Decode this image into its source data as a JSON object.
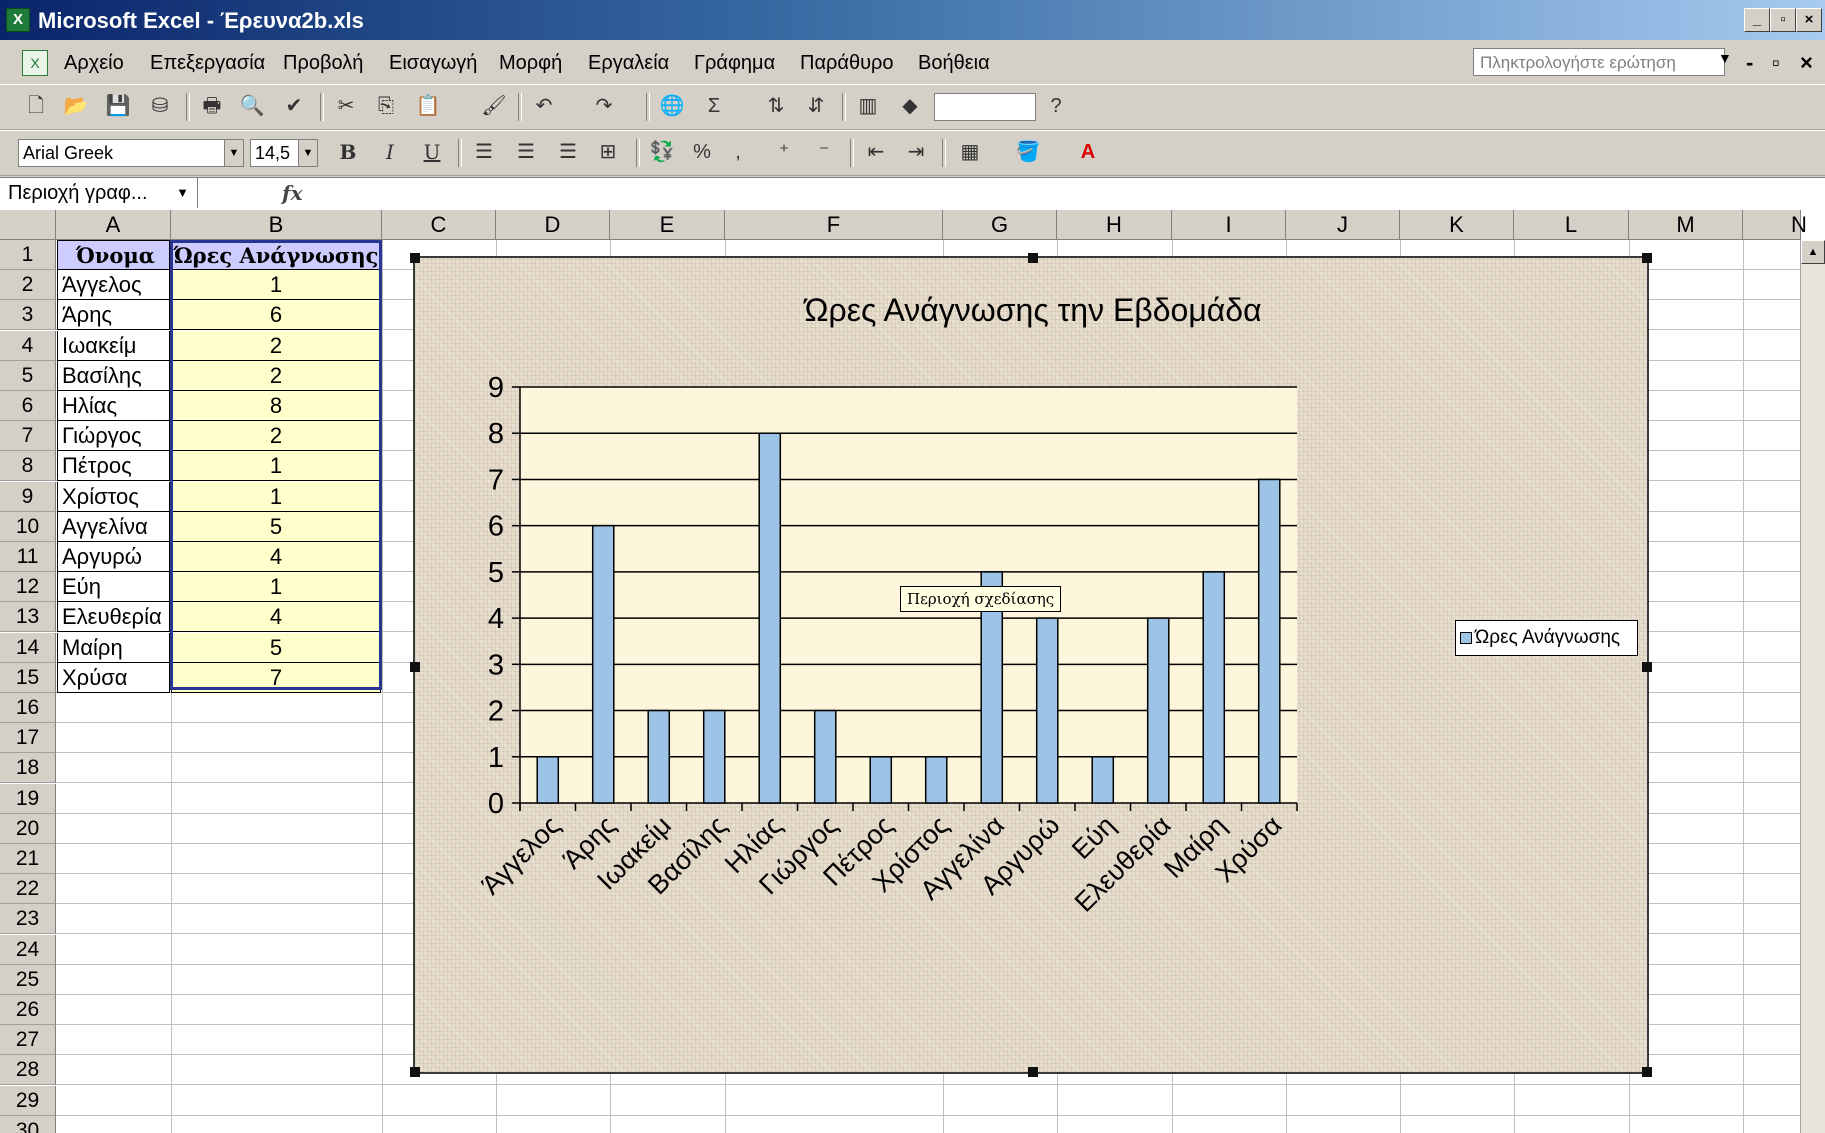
{
  "window": {
    "title": "Microsoft Excel - Έρευνα2b.xls",
    "app_icon": "excel-icon",
    "controls": {
      "minimize": "_",
      "restore": "▫",
      "close": "×"
    }
  },
  "menu": {
    "items": [
      "Αρχείο",
      "Επεξεργασία",
      "Προβολή",
      "Εισαγωγή",
      "Μορφή",
      "Εργαλεία",
      "Γράφημα",
      "Παράθυρο",
      "Βοήθεια"
    ],
    "ask_placeholder": "Πληκτρολογήστε ερώτηση",
    "doc_controls": {
      "minimize": "-",
      "restore": "▫",
      "close": "×"
    }
  },
  "standard_toolbar": {
    "icons": [
      "new-icon",
      "open-icon",
      "save-icon",
      "permission-icon",
      "print-icon",
      "print-preview-icon",
      "spelling-icon",
      "cut-icon",
      "copy-icon",
      "paste-icon",
      "format-painter-icon",
      "undo-icon",
      "redo-icon",
      "hyperlink-icon",
      "autosum-icon",
      "sort-ascending-icon",
      "sort-descending-icon",
      "chart-wizard-icon",
      "drawing-icon",
      "help-icon"
    ],
    "zoom_value": ""
  },
  "format_toolbar": {
    "font": "Arial Greek",
    "font_size": "14,5",
    "bold": "B",
    "italic": "I",
    "underline": "U",
    "percent": "%",
    "comma": ","
  },
  "formula_bar": {
    "name_box": "Περιοχή γραφ...",
    "fx": "fx",
    "content": ""
  },
  "sheet": {
    "columns": [
      "A",
      "B",
      "C",
      "D",
      "E",
      "F",
      "G",
      "H",
      "I",
      "J",
      "K",
      "L",
      "M",
      "N"
    ],
    "rows": [
      "1",
      "2",
      "3",
      "4",
      "5",
      "6",
      "7",
      "8",
      "9",
      "10",
      "11",
      "12",
      "13",
      "14",
      "15",
      "16",
      "17",
      "18",
      "19",
      "20",
      "21",
      "22",
      "23",
      "24",
      "25",
      "26",
      "27",
      "28",
      "29",
      "30"
    ],
    "header": {
      "a": "Όνομα",
      "b": "Ώρες Ανάγνωσης"
    },
    "data": [
      {
        "a": "Άγγελος",
        "b": "1"
      },
      {
        "a": "Άρης",
        "b": "6"
      },
      {
        "a": "Ιωακείμ",
        "b": "2"
      },
      {
        "a": "Βασίλης",
        "b": "2"
      },
      {
        "a": "Ηλίας",
        "b": "8"
      },
      {
        "a": "Γιώργος",
        "b": "2"
      },
      {
        "a": "Πέτρος",
        "b": "1"
      },
      {
        "a": "Χρίστος",
        "b": "1"
      },
      {
        "a": "Αγγελίνα",
        "b": "5"
      },
      {
        "a": "Αργυρώ",
        "b": "4"
      },
      {
        "a": "Εύη",
        "b": "1"
      },
      {
        "a": "Ελευθερία",
        "b": "4"
      },
      {
        "a": "Μαίρη",
        "b": "5"
      },
      {
        "a": "Χρύσα",
        "b": "7"
      }
    ]
  },
  "chart": {
    "tooltip": "Περιοχή σχεδίασης",
    "colors": {
      "bar": "#9dc3e6",
      "plot_bg": "#fdf6dc",
      "bar_outline": "#000000"
    }
  },
  "chart_data": {
    "type": "bar",
    "title": "Ώρες Ανάγνωσης την Εβδομάδα",
    "xlabel": "",
    "ylabel": "",
    "categories": [
      "Άγγελος",
      "Άρης",
      "Ιωακείμ",
      "Βασίλης",
      "Ηλίας",
      "Γιώργος",
      "Πέτρος",
      "Χρίστος",
      "Αγγελίνα",
      "Αργυρώ",
      "Εύη",
      "Ελευθερία",
      "Μαίρη",
      "Χρύσα"
    ],
    "series": [
      {
        "name": "Ώρες Ανάγνωσης",
        "values": [
          1,
          6,
          2,
          2,
          8,
          2,
          1,
          1,
          5,
          4,
          1,
          4,
          5,
          7
        ]
      }
    ],
    "ylim": [
      0,
      9
    ],
    "yticks": [
      "0",
      "1",
      "2",
      "3",
      "4",
      "5",
      "6",
      "7",
      "8",
      "9"
    ],
    "grid": true,
    "legend_position": "right"
  }
}
